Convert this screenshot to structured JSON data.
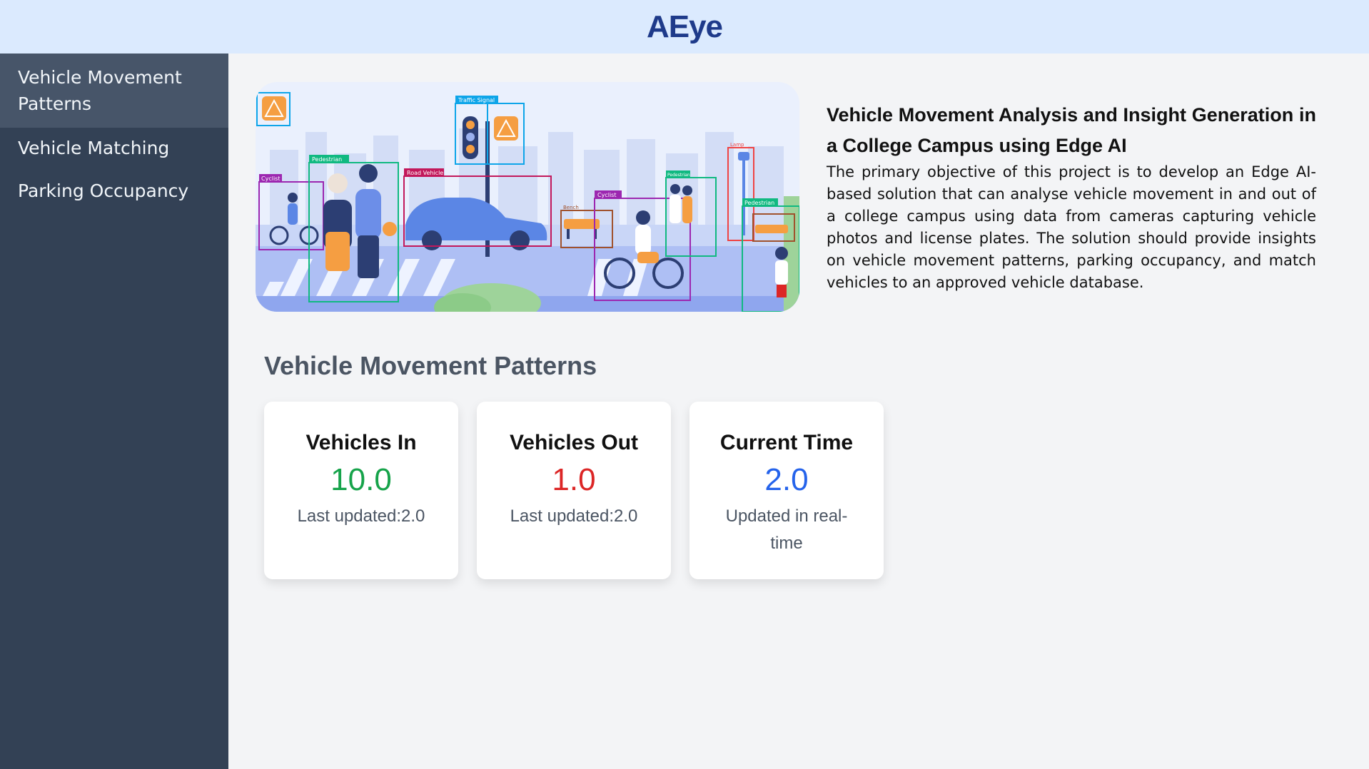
{
  "app": {
    "title": "AEye"
  },
  "sidebar": {
    "items": [
      {
        "label": "Vehicle Movement Patterns"
      },
      {
        "label": "Vehicle Matching"
      },
      {
        "label": "Parking Occupancy"
      }
    ]
  },
  "hero": {
    "labels": {
      "traffic_signal": "Traffic Signal",
      "pedestrian": "Pedestrian",
      "cyclist": "Cyclist",
      "road_vehicle": "Road Vehicle",
      "bench": "Bench",
      "lamp": "Lamp"
    }
  },
  "intro": {
    "title": "Vehicle Movement Analysis and Insight Generation in a College Campus using Edge AI",
    "body": "The primary objective of this project is to develop an Edge AI-based solution that can analyse vehicle movement in and out of a college campus using data from cameras capturing vehicle photos and license plates. The solution should provide insights on vehicle movement patterns, parking occupancy, and match vehicles to an approved vehicle database."
  },
  "section": {
    "title": "Vehicle Movement Patterns"
  },
  "cards": [
    {
      "title": "Vehicles In",
      "value": "10.0",
      "sub": "Last updated:2.0",
      "color": "#16a34a"
    },
    {
      "title": "Vehicles Out",
      "value": "1.0",
      "sub": "Last updated:2.0",
      "color": "#dc2626"
    },
    {
      "title": "Current Time",
      "value": "2.0",
      "sub": "Updated in real-time",
      "color": "#2563eb"
    }
  ]
}
